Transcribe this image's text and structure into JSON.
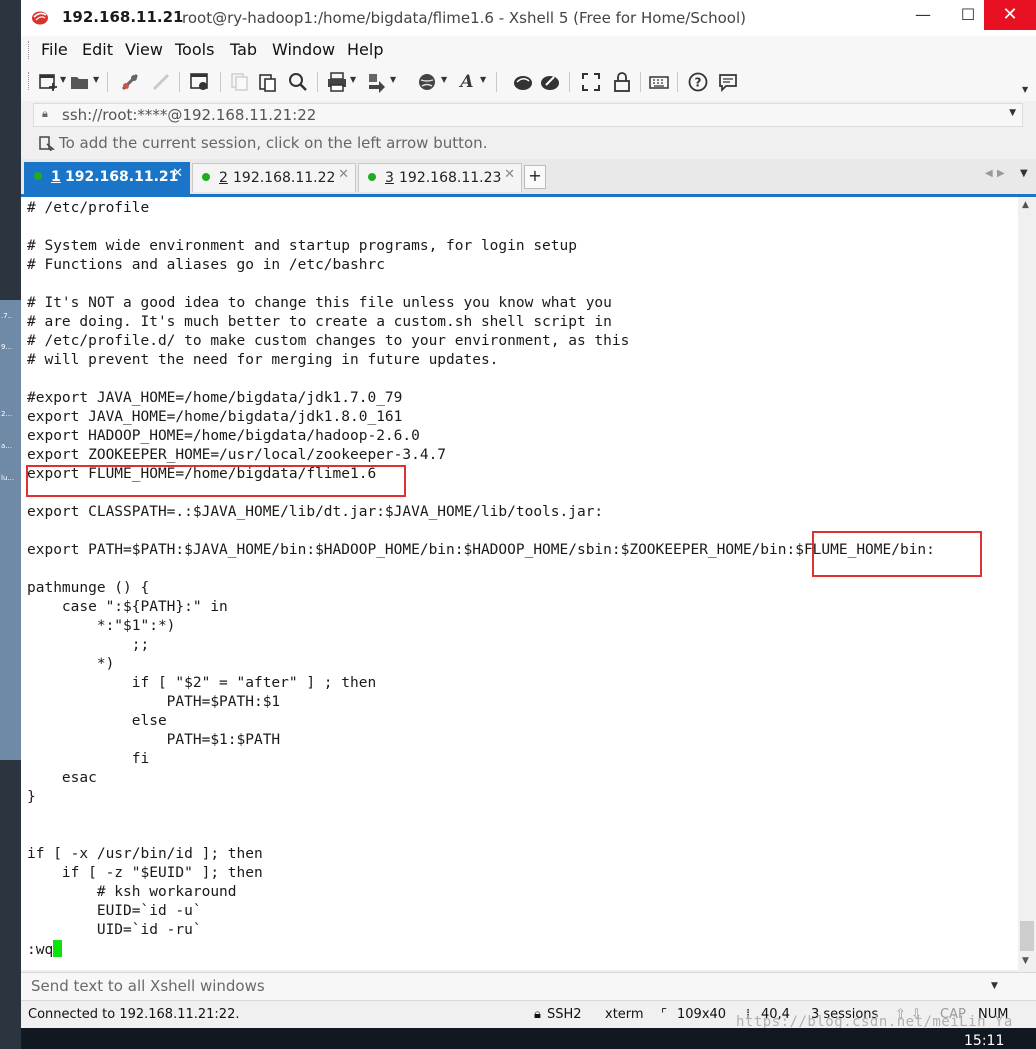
{
  "window": {
    "title_host": "192.168.11.21",
    "title_rest": "root@ry-hadoop1:/home/bigdata/flime1.6 - Xshell 5 (Free for Home/School)",
    "controls": {
      "minimize": "—",
      "maximize": "☐",
      "close": "✕"
    }
  },
  "menu": [
    "File",
    "Edit",
    "View",
    "Tools",
    "Tab",
    "Window",
    "Help"
  ],
  "toolbar": {
    "icons": [
      "new-session-icon",
      "open-folder-icon",
      "reconnect-icon",
      "disconnect-icon",
      "properties-icon",
      "copy-icon",
      "paste-icon",
      "find-icon",
      "print-icon",
      "transfer-icon",
      "globe-icon",
      "font-icon",
      "xftp-icon",
      "compose-icon",
      "fullscreen-icon",
      "lock-icon",
      "keyboard-icon",
      "help-icon",
      "chat-icon"
    ]
  },
  "address": {
    "value": "ssh://root:****@192.168.11.21:22"
  },
  "hint": {
    "text": "To add the current session, click on the left arrow button."
  },
  "tabs": [
    {
      "num": "1",
      "host": "192.168.11.21",
      "active": true
    },
    {
      "num": "2",
      "host": "192.168.11.22",
      "active": false
    },
    {
      "num": "3",
      "host": "192.168.11.23",
      "active": false
    }
  ],
  "terminal": {
    "lines": [
      "# /etc/profile",
      "",
      "# System wide environment and startup programs, for login setup",
      "# Functions and aliases go in /etc/bashrc",
      "",
      "# It's NOT a good idea to change this file unless you know what you",
      "# are doing. It's much better to create a custom.sh shell script in",
      "# /etc/profile.d/ to make custom changes to your environment, as this",
      "# will prevent the need for merging in future updates.",
      "",
      "#export JAVA_HOME=/home/bigdata/jdk1.7.0_79",
      "export JAVA_HOME=/home/bigdata/jdk1.8.0_161",
      "export HADOOP_HOME=/home/bigdata/hadoop-2.6.0",
      "export ZOOKEEPER_HOME=/usr/local/zookeeper-3.4.7",
      "export FLUME_HOME=/home/bigdata/flime1.6",
      "",
      "export CLASSPATH=.:$JAVA_HOME/lib/dt.jar:$JAVA_HOME/lib/tools.jar:",
      "",
      "export PATH=$PATH:$JAVA_HOME/bin:$HADOOP_HOME/bin:$HADOOP_HOME/sbin:$ZOOKEEPER_HOME/bin:$FLUME_HOME/bin:",
      "",
      "pathmunge () {",
      "    case \":${PATH}:\" in",
      "        *:\"$1\":*)",
      "            ;;",
      "        *)",
      "            if [ \"$2\" = \"after\" ] ; then",
      "                PATH=$PATH:$1",
      "            else",
      "                PATH=$1:$PATH",
      "            fi",
      "    esac",
      "}",
      "",
      "",
      "if [ -x /usr/bin/id ]; then",
      "    if [ -z \"$EUID\" ]; then",
      "        # ksh workaround",
      "        EUID=`id -u`",
      "        UID=`id -ru`"
    ],
    "command": ":wq"
  },
  "send_bar": {
    "placeholder": "Send text to all Xshell windows"
  },
  "status": {
    "connection": "Connected to 192.168.11.21:22.",
    "protocol": "SSH2",
    "terminal_type": "xterm",
    "size": "109x40",
    "cursor_pos": "40,4",
    "sessions": "3 sessions",
    "cap": "CAP",
    "num": "NUM"
  },
  "taskbar": {
    "clock": "15:11"
  },
  "watermark": "https://blog.csdn.net/meiLin_Ya",
  "colors": {
    "accent": "#1a74c8",
    "highlight_box": "#e0302f",
    "cursor": "#0be30b",
    "close_button": "#e81123"
  }
}
